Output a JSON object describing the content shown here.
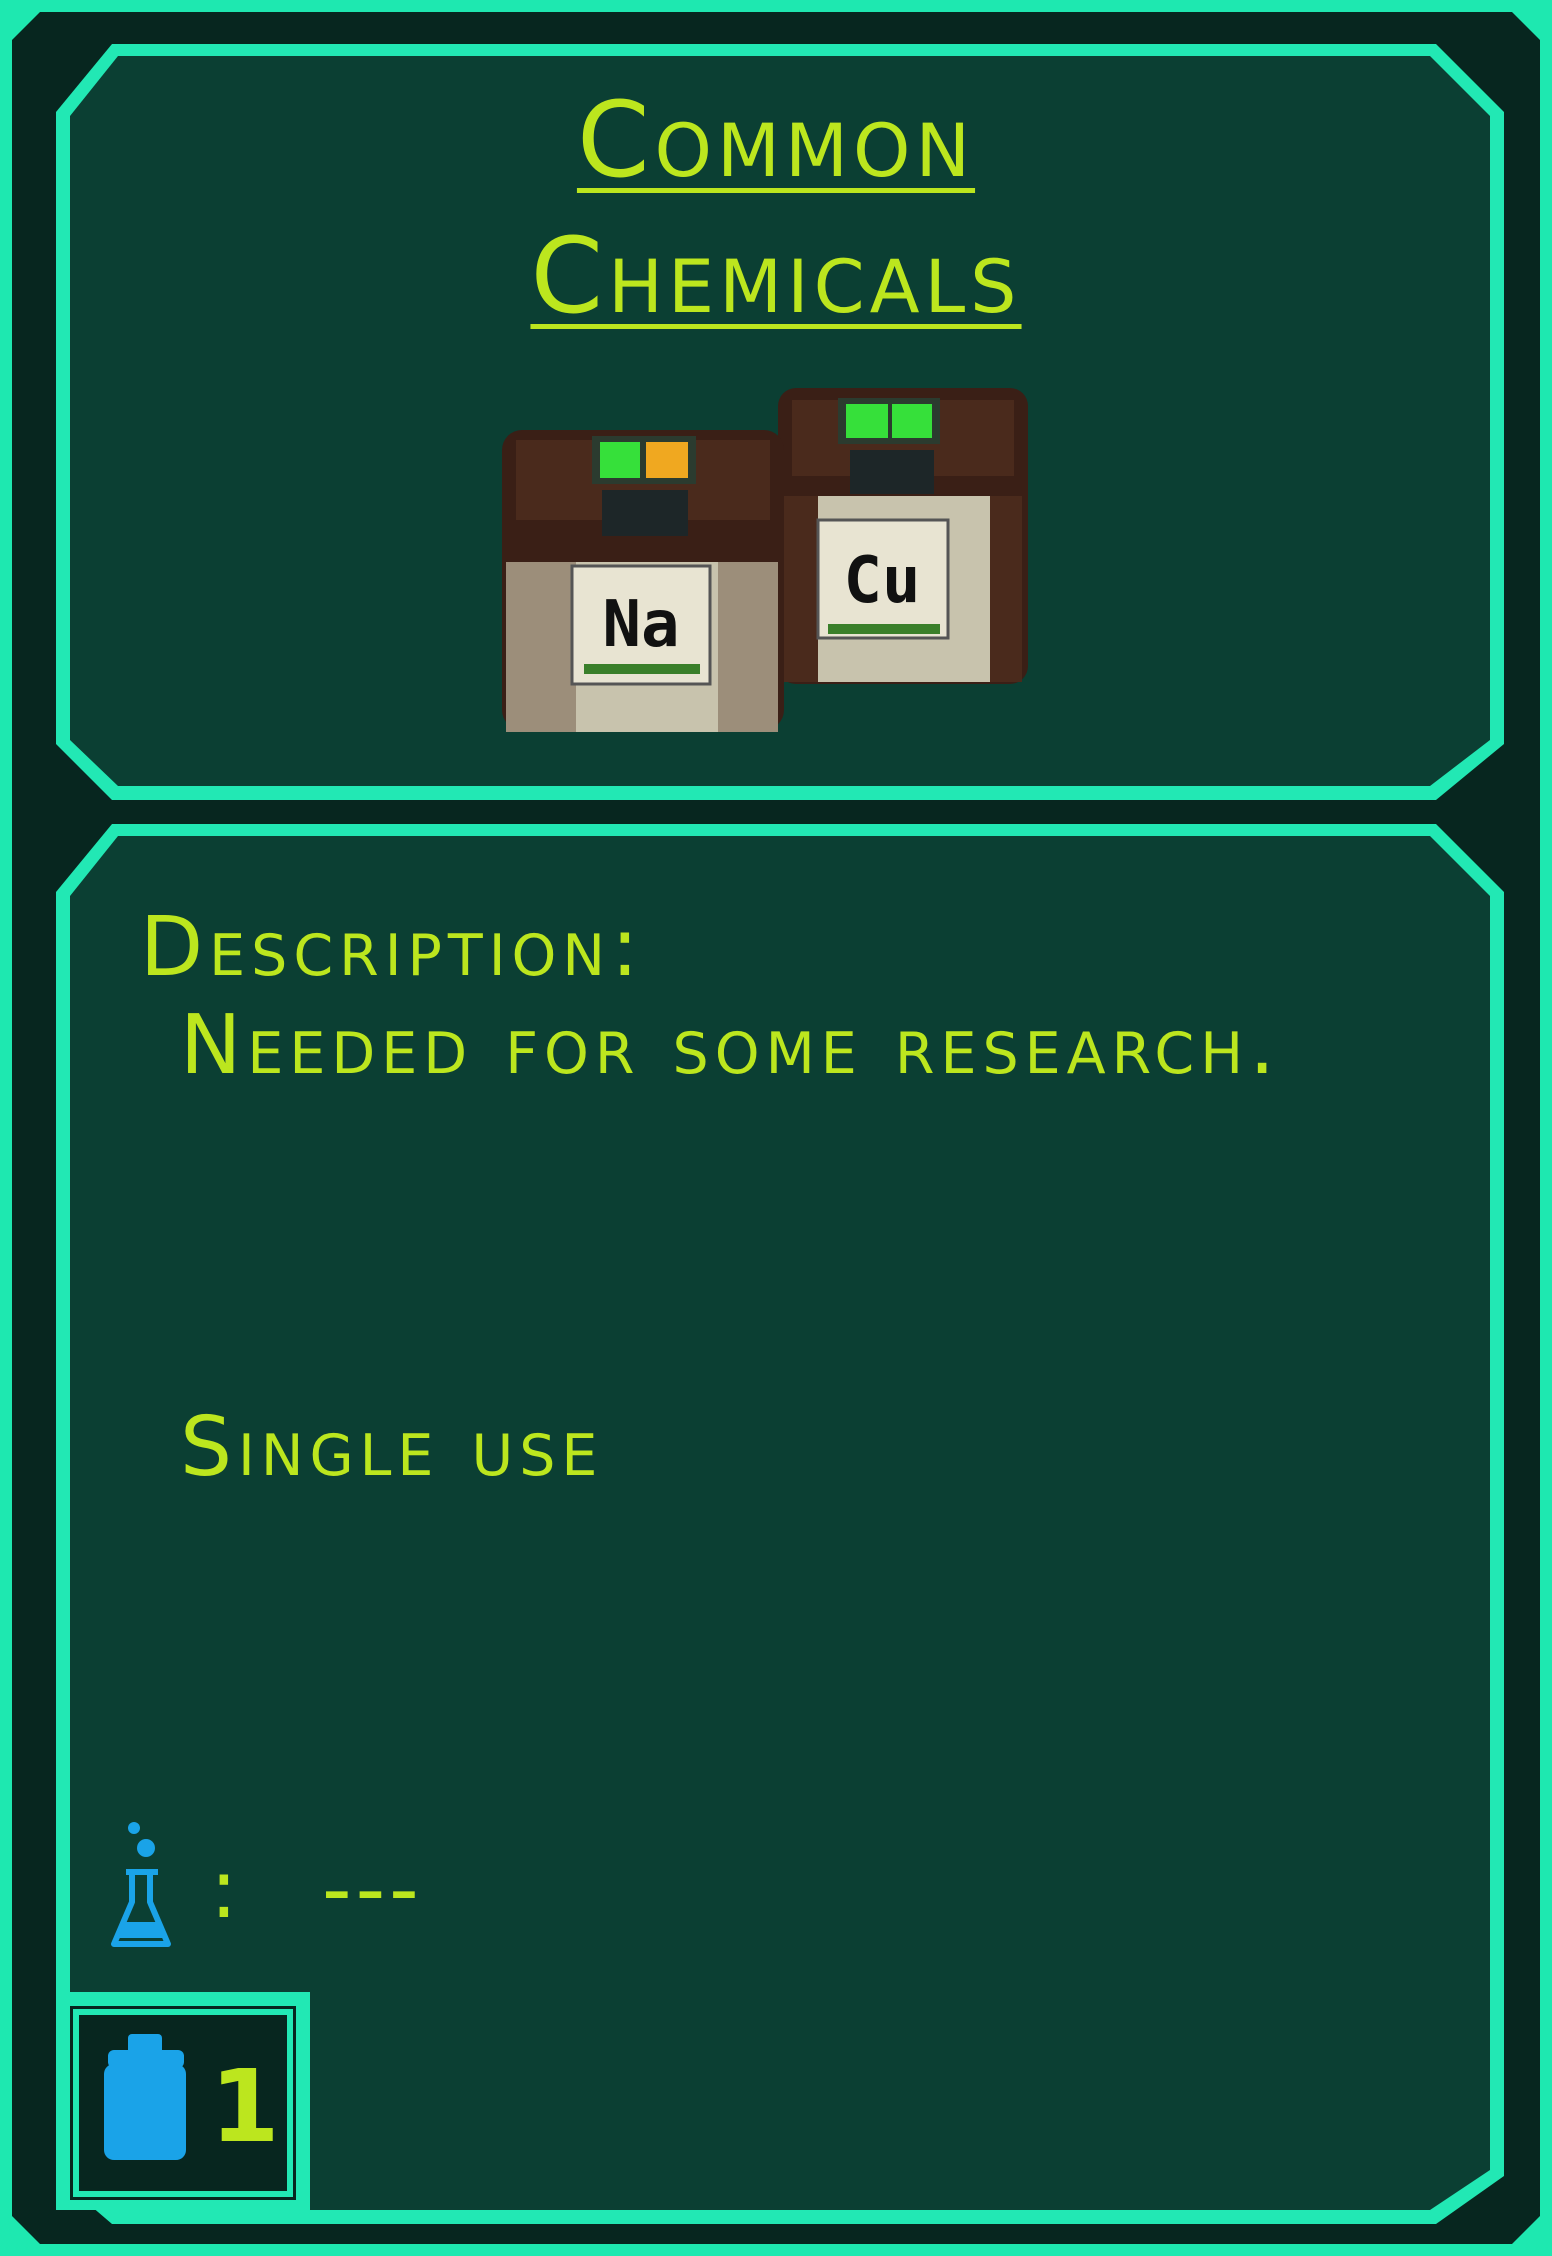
{
  "item": {
    "name_line1": "Common",
    "name_line2": "Chemicals",
    "image_icon": "chemical-canisters-icon",
    "canister_labels": [
      "Na",
      "Cu"
    ],
    "description_label": "Description:",
    "description_text": "Needed for some research.",
    "usage": "Single use",
    "research_icon": "flask-icon",
    "research_separator": ":",
    "research_value": "---",
    "weight_icon": "weight-icon",
    "weight_value": "1"
  },
  "colors": {
    "frame": "#1ee8b0",
    "panel_border": "#22e8b4",
    "panel_fill": "#0b3f33",
    "outer_fill": "#07261f",
    "text": "#bce61e",
    "icon_blue": "#1aa3e8"
  }
}
